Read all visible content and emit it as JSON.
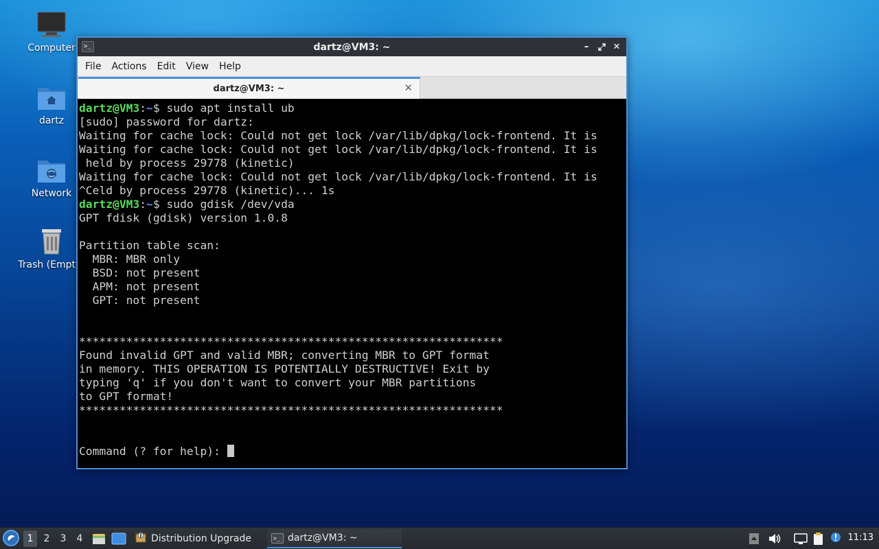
{
  "desktop": {
    "icons": [
      {
        "label": "Computer",
        "icon": "computer-icon"
      },
      {
        "label": "dartz",
        "icon": "home-folder-icon"
      },
      {
        "label": "Network",
        "icon": "network-icon"
      },
      {
        "label": "Trash (Empty)",
        "icon": "trash-icon"
      }
    ]
  },
  "window": {
    "title": "dartz@VM3: ~",
    "menu": [
      "File",
      "Actions",
      "Edit",
      "View",
      "Help"
    ],
    "tab_title": "dartz@VM3: ~",
    "terminal": {
      "user_host": "dartz@VM3",
      "path": "~",
      "lines": [
        "$ sudo apt install ub",
        "[sudo] password for dartz:",
        "Waiting for cache lock: Could not get lock /var/lib/dpkg/lock-frontend. It is",
        "Waiting for cache lock: Could not get lock /var/lib/dpkg/lock-frontend. It is",
        " held by process 29778 (kinetic)",
        "Waiting for cache lock: Could not get lock /var/lib/dpkg/lock-frontend. It is",
        "^Celd by process 29778 (kinetic)... 1s",
        "$ sudo gdisk /dev/vda",
        "GPT fdisk (gdisk) version 1.0.8",
        "",
        "Partition table scan:",
        "  MBR: MBR only",
        "  BSD: not present",
        "  APM: not present",
        "  GPT: not present",
        "",
        "",
        "***************************************************************",
        "Found invalid GPT and valid MBR; converting MBR to GPT format",
        "in memory. THIS OPERATION IS POTENTIALLY DESTRUCTIVE! Exit by",
        "typing 'q' if you don't want to convert your MBR partitions",
        "to GPT format!",
        "***************************************************************",
        "",
        "",
        "Command (? for help): "
      ]
    }
  },
  "taskbar": {
    "workspaces": [
      "1",
      "2",
      "3",
      "4"
    ],
    "active_workspace": "1",
    "tasks": [
      {
        "label": "Distribution Upgrade",
        "icon": "package-icon"
      },
      {
        "label": "dartz@VM3: ~",
        "icon": "terminal-icon"
      }
    ],
    "clock": "11:13"
  },
  "colors": {
    "prompt_user": "#5fd75f",
    "prompt_path": "#5f87ff",
    "accent": "#4a90d9"
  }
}
